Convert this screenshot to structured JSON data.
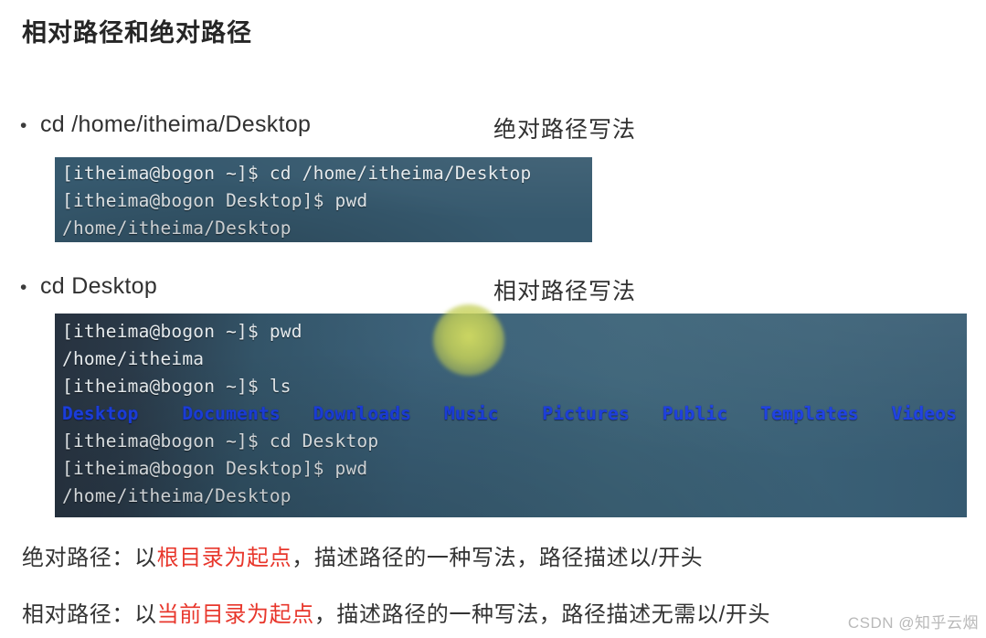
{
  "slide": {
    "title": "相对路径和绝对路径"
  },
  "bullets": [
    {
      "marker": "•",
      "command": "cd /home/itheima/Desktop",
      "note": "绝对路径写法"
    },
    {
      "marker": "•",
      "command": "cd Desktop",
      "note": "相对路径写法"
    }
  ],
  "terminals": [
    {
      "name": "absolute-path-terminal",
      "lines": [
        "[itheima@bogon ~]$ cd /home/itheima/Desktop",
        "[itheima@bogon Desktop]$ pwd",
        "/home/itheima/Desktop"
      ]
    },
    {
      "name": "relative-path-terminal",
      "lines": [
        "[itheima@bogon ~]$ pwd",
        "/home/itheima",
        "[itheima@bogon ~]$ ls",
        "__LS_ROW__",
        "[itheima@bogon ~]$ cd Desktop",
        "[itheima@bogon Desktop]$ pwd",
        "/home/itheima/Desktop"
      ],
      "ls_entries": [
        "Desktop",
        "Documents",
        "Downloads",
        "Music",
        "Pictures",
        "Public",
        "Templates",
        "Videos"
      ]
    }
  ],
  "definitions": [
    {
      "label": "绝对路径：以",
      "highlight": "根目录为起点",
      "rest": "，描述路径的一种写法，路径描述以/开头"
    },
    {
      "label": "相对路径：以",
      "highlight": "当前目录为起点",
      "rest": "，描述路径的一种写法，路径描述无需以/开头"
    }
  ],
  "watermark": "CSDN @知乎云烟",
  "colors": {
    "highlight_red": "#e8372c",
    "terminal_blue": "#3b6079",
    "directory_blue": "#1c3fe0",
    "pointer_glow": "#d8e060",
    "title_text": "#262626"
  }
}
